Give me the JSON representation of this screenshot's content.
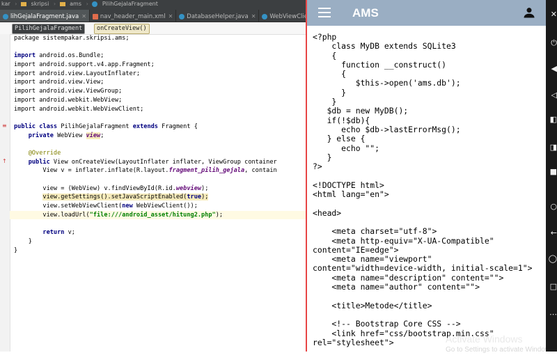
{
  "ide": {
    "breadcrumb": [
      "kar",
      "skripsi",
      "ams",
      "PilihGejalaFragment"
    ],
    "tabs": [
      {
        "label": "lihGejalaFragment.java",
        "color": "#3592c4",
        "active": true
      },
      {
        "label": "nav_header_main.xml",
        "color": "#e06c4c",
        "active": false
      },
      {
        "label": "DatabaseHelper.java",
        "color": "#3592c4",
        "active": false
      },
      {
        "label": "WebViewClient.java",
        "color": "#3592c4",
        "active": false
      }
    ],
    "structure_chips": [
      "PilihGejalaFragment",
      "onCreateView()"
    ],
    "code": {
      "l1": "package sistempakar.skripsi.ams;",
      "l3": "import android.os.Bundle;",
      "l4": "import android.support.v4.app.Fragment;",
      "l5": "import android.view.LayoutInflater;",
      "l6": "import android.view.View;",
      "l7": "import android.view.ViewGroup;",
      "l8": "import android.webkit.WebView;",
      "l9": "import android.webkit.WebViewClient;",
      "l11a": "public class",
      "l11b": " PilihGejalaFragment ",
      "l11c": "extends",
      "l11d": " Fragment {",
      "l12a": "    private",
      "l12b": " WebView ",
      "l12c": "view",
      "l12d": ";",
      "l14": "    @Override",
      "l15a": "    public",
      "l15b": " View onCreateView(LayoutInflater inflater, ViewGroup container",
      "l16a": "        View v = inflater.inflate(R.layout.",
      "l16b": "fragment_pilih_gejala",
      "l16c": ", contain",
      "l18a": "        view = (WebView) v.findViewById(R.id.",
      "l18b": "webview",
      "l18c": ");",
      "l19a": "view.getSettings().setJavaScriptEnabled(",
      "l19b": "true",
      "l19c": ");",
      "l20a": "        view.setWebViewClient(",
      "l20b": "new",
      "l20c": " WebViewClient());",
      "l21a": "        view.loadUrl(",
      "l21b": "\"file:///android_asset/hitung2.php\"",
      "l21c": ");",
      "l23a": "        return",
      "l23b": " v;",
      "l24": "    }",
      "l25": "}"
    }
  },
  "phone": {
    "title": "AMS",
    "appbar_color": "#9aaec3",
    "source_text": "<?php\n    class MyDB extends SQLite3\n    {\n      function __construct()\n      {\n         $this->open('ams.db');\n      }\n    }\n   $db = new MyDB();\n   if(!$db){\n      echo $db->lastErrorMsg();\n   } else {\n      echo \"\";\n   }\n?>\n\n<!DOCTYPE html>\n<html lang=\"en\">\n\n<head>\n\n    <meta charset=\"utf-8\">\n    <meta http-equiv=\"X-UA-Compatible\"\ncontent=\"IE=edge\">\n    <meta name=\"viewport\"\ncontent=\"width=device-width, initial-scale=1\">\n    <meta name=\"description\" content=\"\">\n    <meta name=\"author\" content=\"\">\n\n    <title>Metode</title>\n\n    <!-- Bootstrap Core CSS -->\n    <link href=\"css/bootstrap.min.css\"\nrel=\"stylesheet\">"
  },
  "watermark": {
    "title": "Activate Windows",
    "subtitle": "Go to Settings to activate Window"
  }
}
